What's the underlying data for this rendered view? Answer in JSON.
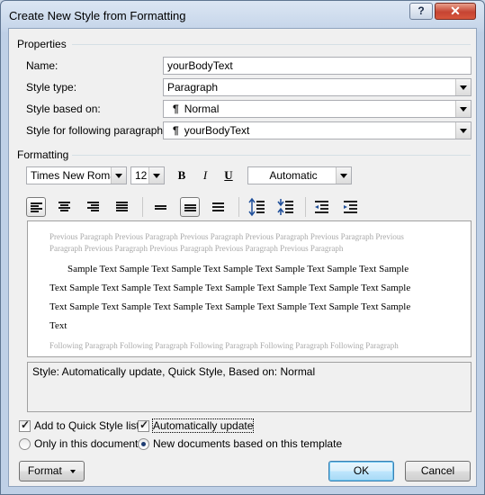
{
  "window": {
    "title": "Create New Style from Formatting",
    "help_label": "?",
    "close_label": "✕"
  },
  "properties": {
    "section_label": "Properties",
    "name_label": "Name:",
    "name_value": "yourBodyText",
    "style_type_label": "Style type:",
    "style_type_value": "Paragraph",
    "based_on_label": "Style based on:",
    "based_on_value": "Normal",
    "following_label": "Style for following paragraph:",
    "following_value": "yourBodyText",
    "pilcrow": "¶"
  },
  "formatting": {
    "section_label": "Formatting",
    "font": "Times New Roman",
    "size": "12",
    "bold": "B",
    "italic": "I",
    "underline": "U",
    "color": "Automatic"
  },
  "preview": {
    "previous": "Previous Paragraph Previous Paragraph Previous Paragraph Previous Paragraph Previous Paragraph Previous Paragraph Previous Paragraph Previous Paragraph Previous Paragraph Previous Paragraph",
    "sample_1": "Sample Text Sample Text Sample Text Sample Text Sample Text Sample Text Sample",
    "sample_2": "Text Sample Text Sample Text Sample Text Sample Text Sample Text Sample Text Sample",
    "sample_3": "Text Sample Text Sample Text Sample Text Sample Text Sample Text Sample Text Sample",
    "sample_4": "Text",
    "following": "Following Paragraph Following Paragraph Following Paragraph Following Paragraph Following Paragraph"
  },
  "description": "Style: Automatically update, Quick Style, Based on: Normal",
  "options": {
    "add_quick_style": "Add to Quick Style list",
    "add_quick_style_checked": true,
    "auto_update": "Automatically update",
    "auto_update_checked": true,
    "only_doc": "Only in this document",
    "new_docs": "New documents based on this template",
    "selected_scope": "new_docs"
  },
  "buttons": {
    "format": "Format",
    "ok": "OK",
    "cancel": "Cancel"
  }
}
